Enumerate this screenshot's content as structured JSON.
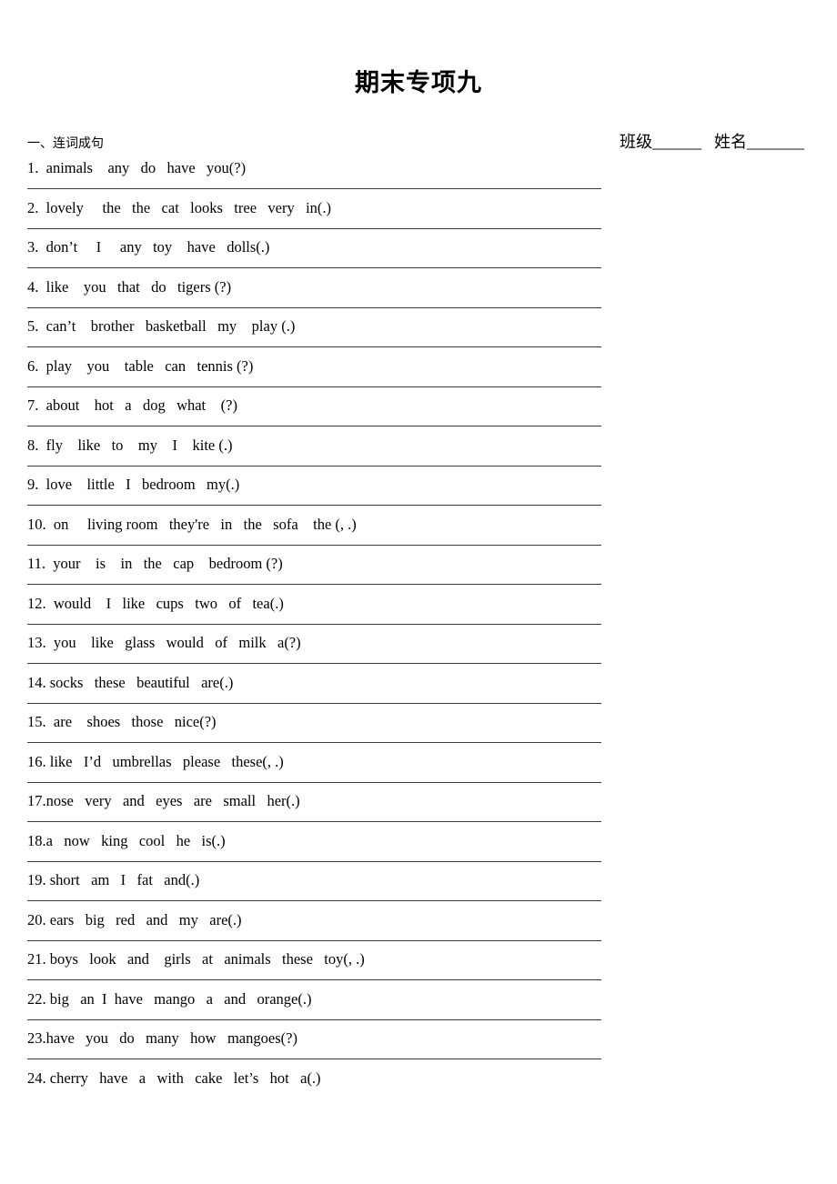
{
  "document": {
    "title": "期末专项九",
    "header_fields": {
      "class_label": "班级",
      "class_blank": "______",
      "name_label": "姓名",
      "name_blank": "_______"
    },
    "section_heading": "一、连词成句"
  },
  "questions": [
    {
      "number": "1.",
      "text": "1.  animals    any   do   have   you(?)"
    },
    {
      "number": "2.",
      "text": "2.  lovely     the   the   cat   looks   tree   very   in(.)"
    },
    {
      "number": "3.",
      "text": "3.  don’t     I     any   toy    have   dolls(.)"
    },
    {
      "number": "4.",
      "text": "4.  like    you   that   do   tigers (?)"
    },
    {
      "number": "5.",
      "text": "5.  can’t    brother   basketball   my    play (.)"
    },
    {
      "number": "6.",
      "text": "6.  play    you    table   can   tennis (?)"
    },
    {
      "number": "7.",
      "text": "7.  about    hot   a   dog   what    (?)"
    },
    {
      "number": "8.",
      "text": "8.  fly    like   to    my    I    kite (.)"
    },
    {
      "number": "9.",
      "text": "9.  love    little   I   bedroom   my(.)"
    },
    {
      "number": "10.",
      "text": "10.  on     living room   they're   in   the   sofa    the (, .)"
    },
    {
      "number": "11.",
      "text": "11.  your    is    in   the   cap    bedroom (?)"
    },
    {
      "number": "12.",
      "text": "12.  would    I   like   cups   two   of   tea(.)"
    },
    {
      "number": "13.",
      "text": "13.  you    like   glass   would   of   milk   a(?)"
    },
    {
      "number": "14.",
      "text": "14. socks   these   beautiful   are(.)"
    },
    {
      "number": "15.",
      "text": "15.  are    shoes   those   nice(?)"
    },
    {
      "number": "16.",
      "text": "16. like   I’d   umbrellas   please   these(, .)"
    },
    {
      "number": "17.",
      "text": "17.nose   very   and   eyes   are   small   her(.)"
    },
    {
      "number": "18.",
      "text": "18.a   now   king   cool   he   is(.)"
    },
    {
      "number": "19.",
      "text": "19. short   am   I   fat   and(.)"
    },
    {
      "number": "20.",
      "text": "20. ears   big   red   and   my   are(.)"
    },
    {
      "number": "21.",
      "text": "21. boys   look   and    girls   at   animals   these   toy(, .)"
    },
    {
      "number": "22.",
      "text": "22. big   an  I  have   mango   a   and   orange(.)"
    },
    {
      "number": "23.",
      "text": "23.have   you   do   many   how   mangoes(?)"
    },
    {
      "number": "24.",
      "text": "24. cherry   have   a   with   cake   let’s   hot   a(.)"
    }
  ]
}
